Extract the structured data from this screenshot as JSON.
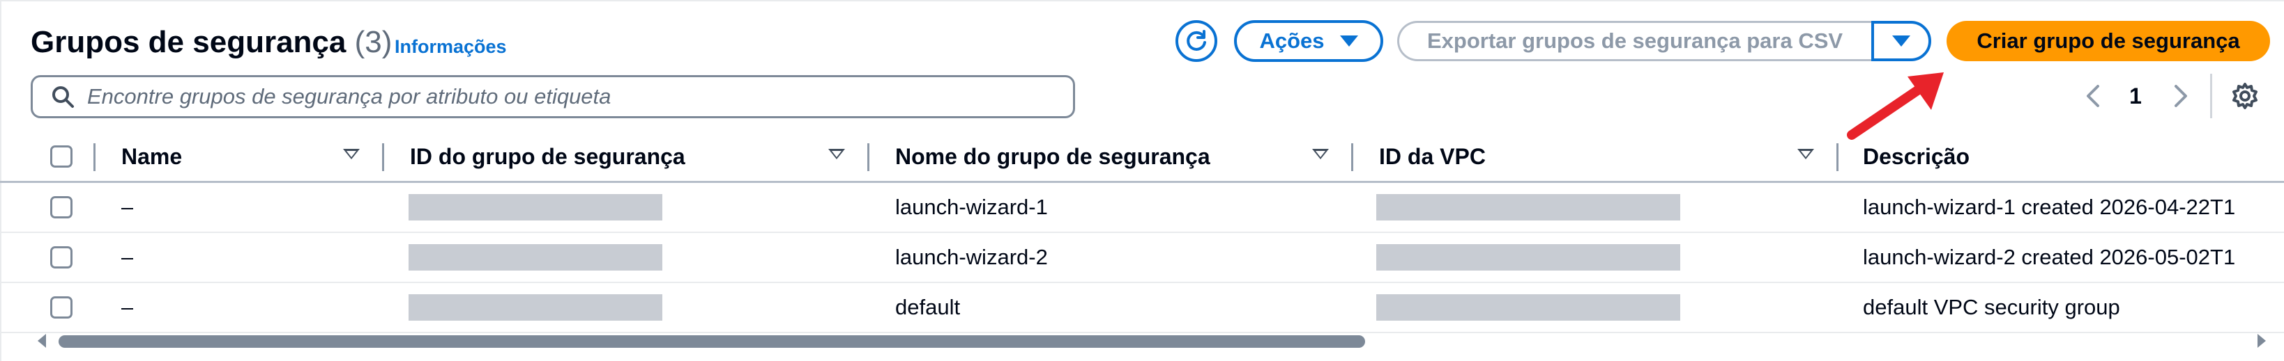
{
  "header": {
    "title": "Grupos de segurança",
    "count": "(3)",
    "info_link": "Informações"
  },
  "toolbar": {
    "refresh_icon": "refresh-icon",
    "actions_label": "Ações",
    "export_label": "Exportar grupos de segurança para CSV",
    "create_label": "Criar grupo de segurança"
  },
  "search": {
    "placeholder": "Encontre grupos de segurança por atributo ou etiqueta",
    "value": ""
  },
  "pagination": {
    "current_page": "1"
  },
  "table": {
    "columns": [
      "Name",
      "ID do grupo de segurança",
      "Nome do grupo de segurança",
      "ID da VPC",
      "Descrição"
    ],
    "rows": [
      {
        "name": "–",
        "group_name": "launch-wizard-1",
        "description": "launch-wizard-1 created 2026-04-22T1"
      },
      {
        "name": "–",
        "group_name": "launch-wizard-2",
        "description": "launch-wizard-2 created 2026-05-02T1"
      },
      {
        "name": "–",
        "group_name": "default",
        "description": "default VPC security group"
      }
    ]
  },
  "colors": {
    "accent": "#0972d3",
    "primary_button": "#ff9900",
    "annotation_arrow": "#e8232a"
  }
}
